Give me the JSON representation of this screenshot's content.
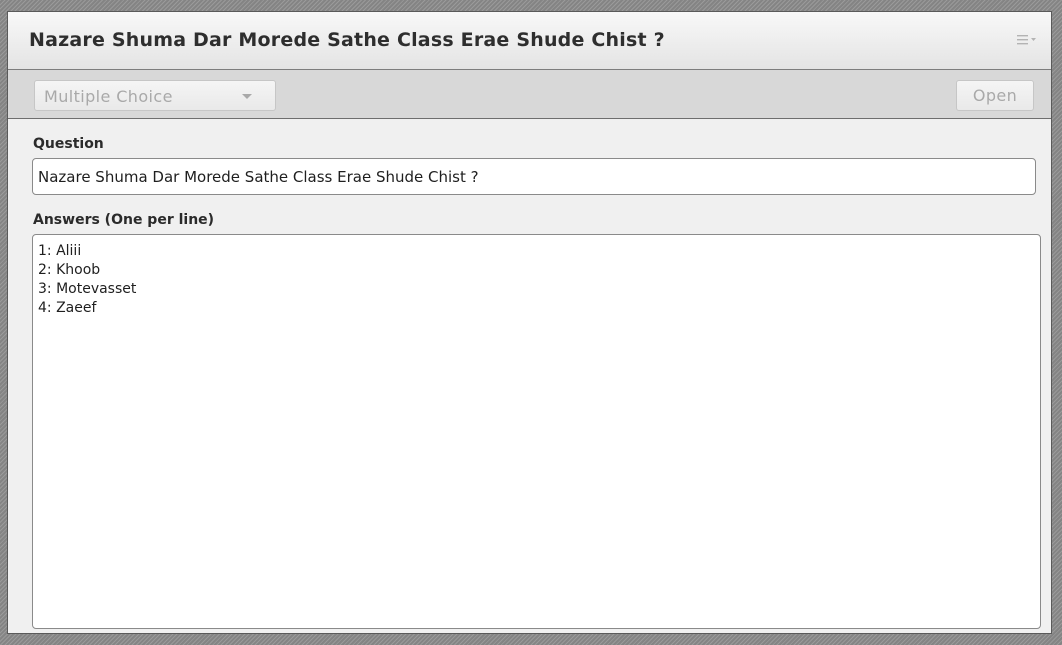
{
  "pod": {
    "title": "Nazare Shuma Dar Morede Sathe Class Erae Shude Chist ?",
    "menu_icon": "hamburger-menu-icon"
  },
  "toolbar": {
    "question_type": "Multiple Choice",
    "dropdown_icon": "chevron-down-icon",
    "open_label": "Open"
  },
  "question": {
    "label": "Question",
    "value": "Nazare Shuma Dar Morede Sathe Class Erae Shude Chist ?"
  },
  "answers": {
    "label": "Answers (One per line)",
    "lines": [
      "1: Aliii",
      "2: Khoob",
      "3: Motevasset",
      "4: Zaeef"
    ]
  },
  "colors": {
    "accent_text": "#2e2e2e",
    "disabled_text": "#a9a9a9",
    "panel_bg": "#f0f0f0"
  }
}
